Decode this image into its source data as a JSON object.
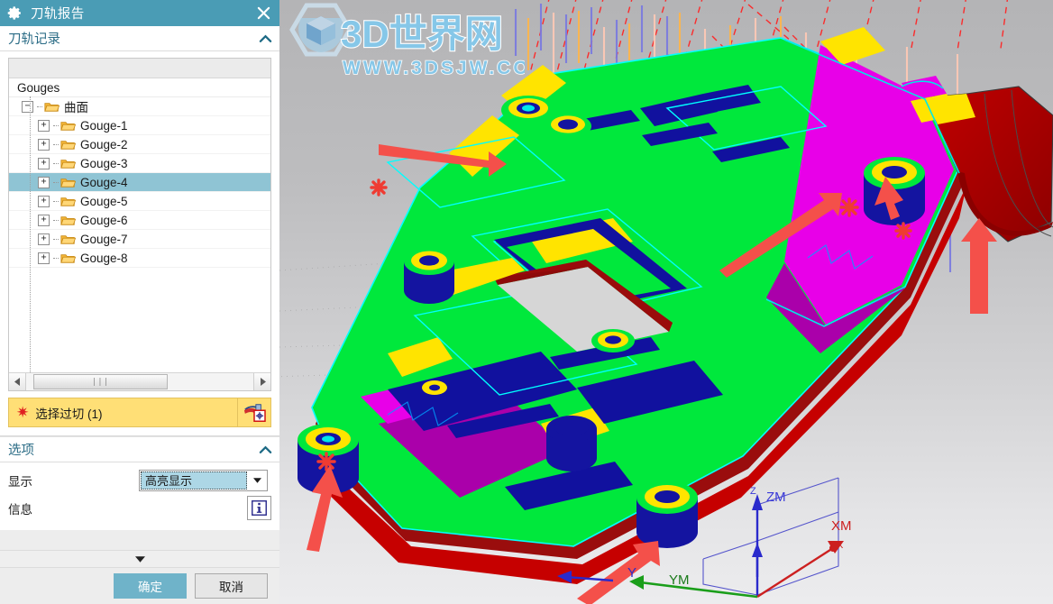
{
  "window": {
    "title": "刀轨报告",
    "gear_icon": "gear-icon",
    "close_icon": "close-icon"
  },
  "sections": {
    "toolpath_record": {
      "title": "刀轨记录",
      "collapse_icon": "chevron-up-icon"
    },
    "options": {
      "title": "选项",
      "collapse_icon": "chevron-up-icon"
    }
  },
  "tree": {
    "column_header": "",
    "header_label": "Gouges",
    "root": {
      "label": "曲面",
      "expander": "−",
      "icon": "folder-open-icon"
    },
    "items": [
      {
        "label": "Gouge-1",
        "expander": "+",
        "icon": "folder-open-icon",
        "selected": false
      },
      {
        "label": "Gouge-2",
        "expander": "+",
        "icon": "folder-open-icon",
        "selected": false
      },
      {
        "label": "Gouge-3",
        "expander": "+",
        "icon": "folder-open-icon",
        "selected": false
      },
      {
        "label": "Gouge-4",
        "expander": "+",
        "icon": "folder-open-icon",
        "selected": true
      },
      {
        "label": "Gouge-5",
        "expander": "+",
        "icon": "folder-open-icon",
        "selected": false
      },
      {
        "label": "Gouge-6",
        "expander": "+",
        "icon": "folder-open-icon",
        "selected": false
      },
      {
        "label": "Gouge-7",
        "expander": "+",
        "icon": "folder-open-icon",
        "selected": false
      },
      {
        "label": "Gouge-8",
        "expander": "+",
        "icon": "folder-open-icon",
        "selected": false
      }
    ],
    "scrollbar": {
      "left_arrow": "◀",
      "right_arrow": "▶",
      "grip": "⦀"
    }
  },
  "selection": {
    "required_marker": "✷",
    "label": "选择过切 (1)",
    "picker_icon": "select-gouge-icon"
  },
  "options_panel": {
    "display_label": "显示",
    "display_value": "高亮显示",
    "dropdown_icon": "chevron-down-icon",
    "info_label": "信息",
    "info_icon": "information-icon"
  },
  "collapse_strip": {
    "icon": "chevron-down-icon"
  },
  "footer": {
    "ok_label": "确定",
    "cancel_label": "取消"
  },
  "viewport": {
    "axes": [
      {
        "name": "ZM",
        "color": "#2a2acc"
      },
      {
        "name": "XM",
        "color": "#cc2020"
      },
      {
        "name": "YM",
        "color": "#1a9e1a"
      },
      {
        "name": "Y",
        "color": "#2a2acc"
      }
    ],
    "background_top": "#b4b4b6",
    "background_bottom": "#ececee",
    "model_colors": {
      "green_surface": "#00e83c",
      "magenta_surface": "#e800e8",
      "dark_blue_surface": "#1414a0",
      "yellow_surface": "#ffe400",
      "dark_red_surface": "#8e0a0a",
      "bright_red_surface": "#d40000",
      "toolpath_red": "#ff2020",
      "toolpath_blue": "#7070e0",
      "toolpath_orange": "#ffb040",
      "edge_cyan": "#00e8e8",
      "arrow_red": "#f4504a"
    },
    "gouge_markers": 6
  },
  "watermark": {
    "brand": "3D世界网",
    "url": "WWW.3DSJW.COM",
    "logo_icon": "cube-logo-icon"
  }
}
